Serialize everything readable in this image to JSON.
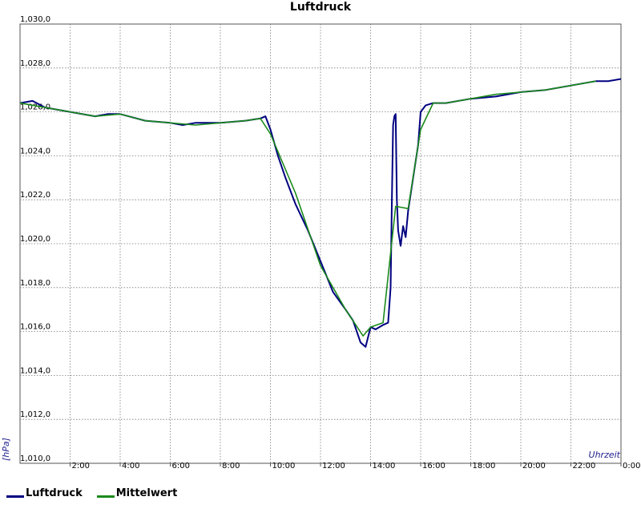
{
  "chart_data": {
    "type": "line",
    "title": "Luftdruck",
    "xlabel": "Uhrzeit",
    "ylabel": "[hPa]",
    "xlim": [
      0,
      24
    ],
    "ylim": [
      1010,
      1030
    ],
    "x_tick_labels": [
      "2:00",
      "4:00",
      "6:00",
      "8:00",
      "10:00",
      "12:00",
      "14:00",
      "16:00",
      "18:00",
      "20:00",
      "22:00",
      "0:00"
    ],
    "y_tick_labels": [
      "1,010,0",
      "1,012,0",
      "1,014,0",
      "1,016,0",
      "1,018,0",
      "1,020,0",
      "1,022,0",
      "1,024,0",
      "1,026,0",
      "1,028,0",
      "1,030,0"
    ],
    "grid": true,
    "legend_position": "bottom-left",
    "series": [
      {
        "name": "Luftdruck",
        "color": "#000080",
        "x": [
          0,
          0.5,
          1,
          2,
          3,
          3.5,
          4,
          5,
          6,
          6.5,
          7,
          8,
          9,
          9.6,
          9.8,
          10,
          10.3,
          10.6,
          11,
          11.5,
          12,
          12.5,
          13,
          13.3,
          13.6,
          13.8,
          14,
          14.2,
          14.5,
          14.7,
          14.8,
          14.85,
          14.9,
          14.95,
          15.0,
          15.05,
          15.1,
          15.2,
          15.3,
          15.4,
          15.5,
          15.7,
          15.9,
          16.0,
          16.2,
          16.5,
          17,
          18,
          19,
          20,
          21,
          22,
          23,
          23.5,
          24
        ],
        "y": [
          1026.4,
          1026.5,
          1026.2,
          1026.0,
          1025.8,
          1025.9,
          1025.9,
          1025.6,
          1025.5,
          1025.4,
          1025.5,
          1025.5,
          1025.6,
          1025.7,
          1025.8,
          1025.2,
          1024.0,
          1023.0,
          1021.8,
          1020.6,
          1019.2,
          1017.8,
          1017.0,
          1016.5,
          1015.5,
          1015.3,
          1016.2,
          1016.1,
          1016.3,
          1016.4,
          1018.0,
          1022.0,
          1025.4,
          1025.8,
          1025.9,
          1022.0,
          1020.6,
          1019.9,
          1020.8,
          1020.3,
          1021.5,
          1023.0,
          1024.5,
          1026.0,
          1026.3,
          1026.4,
          1026.4,
          1026.6,
          1026.7,
          1026.9,
          1027.0,
          1027.2,
          1027.4,
          1027.4,
          1027.5
        ]
      },
      {
        "name": "Mittelwert",
        "color": "#1b8a1b",
        "x": [
          0,
          1,
          2,
          3,
          4,
          5,
          6,
          7,
          8,
          9,
          9.6,
          10,
          11,
          12,
          13,
          13.7,
          14,
          14.5,
          15,
          15.5,
          16,
          16.5,
          17,
          18,
          19,
          20,
          21,
          22,
          23
        ],
        "y": [
          1026.4,
          1026.2,
          1026.0,
          1025.8,
          1025.9,
          1025.6,
          1025.5,
          1025.4,
          1025.5,
          1025.6,
          1025.7,
          1025.0,
          1022.3,
          1019.0,
          1017.0,
          1015.8,
          1016.2,
          1016.4,
          1021.7,
          1021.6,
          1025.2,
          1026.4,
          1026.4,
          1026.6,
          1026.8,
          1026.9,
          1027.0,
          1027.2,
          1027.4
        ]
      }
    ]
  }
}
